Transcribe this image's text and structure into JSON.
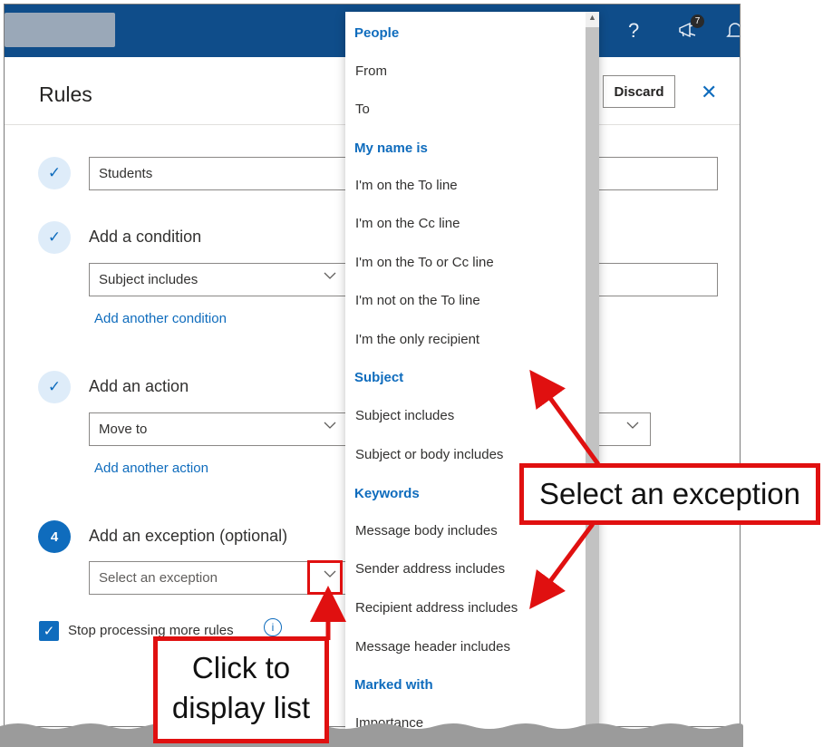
{
  "header": {
    "help_glyph": "?",
    "notification_count": "7"
  },
  "rules": {
    "title": "Rules",
    "discard_label": "Discard",
    "close_glyph": "✕"
  },
  "steps": {
    "name_value": "Students",
    "condition_label": "Add a condition",
    "condition_value": "Subject includes",
    "add_condition_link": "Add another condition",
    "action_label": "Add an action",
    "action_value": "Move to",
    "add_action_link": "Add another action",
    "exception_step_number": "4",
    "exception_label": "Add an exception (optional)",
    "exception_placeholder": "Select an exception",
    "stop_processing_label": "Stop processing more rules",
    "info_glyph": "i"
  },
  "dropdown": {
    "groups": [
      {
        "header": "People",
        "items": [
          "From",
          "To"
        ]
      },
      {
        "header": "My name is",
        "items": [
          "I'm on the To line",
          "I'm on the Cc line",
          "I'm on the To or Cc line",
          "I'm not on the To line",
          "I'm the only recipient"
        ]
      },
      {
        "header": "Subject",
        "items": [
          "Subject includes",
          "Subject or body includes"
        ]
      },
      {
        "header": "Keywords",
        "items": [
          "Message body includes",
          "Sender address includes",
          "Recipient address includes",
          "Message header includes"
        ]
      },
      {
        "header": "Marked with",
        "items": [
          "Importance"
        ]
      }
    ]
  },
  "annotations": {
    "callout_exception": "Select an exception",
    "callout_click_line1": "Click to",
    "callout_click_line2": "display list",
    "accent_color": "#e01010"
  },
  "colors": {
    "topbar": "#0f4d8a",
    "brand_blue": "#0f6cbd"
  }
}
